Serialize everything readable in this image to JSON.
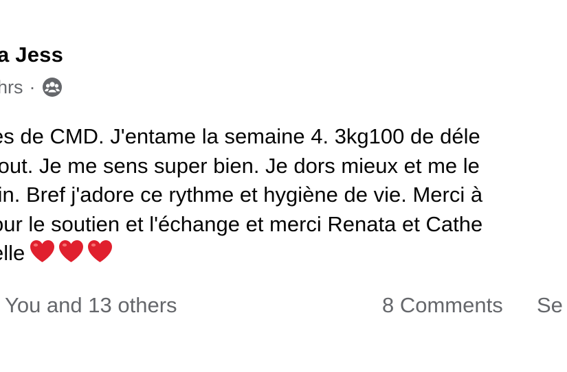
{
  "post": {
    "author": "a Jess",
    "timestamp": "hrs",
    "separator": "·",
    "audience_icon": "group-icon",
    "body_lines": [
      "es de CMD. J'entame la semaine 4. 3kg100 de déle",
      " tout. Je me sens super bien. Je dors mieux et me le",
      "tin. Bref j'adore ce rythme et hygiène de vie. Merci à",
      "our le soutien et l'échange et merci Renata et Cathe",
      "elle"
    ],
    "emoji": [
      "heart-emoji",
      "heart-emoji",
      "heart-emoji"
    ]
  },
  "footer": {
    "reactions": "You and 13 others",
    "comments": "8 Comments",
    "seen": "Se"
  },
  "colors": {
    "text": "#050505",
    "secondary": "#65676b",
    "heart": "#e0202e"
  }
}
